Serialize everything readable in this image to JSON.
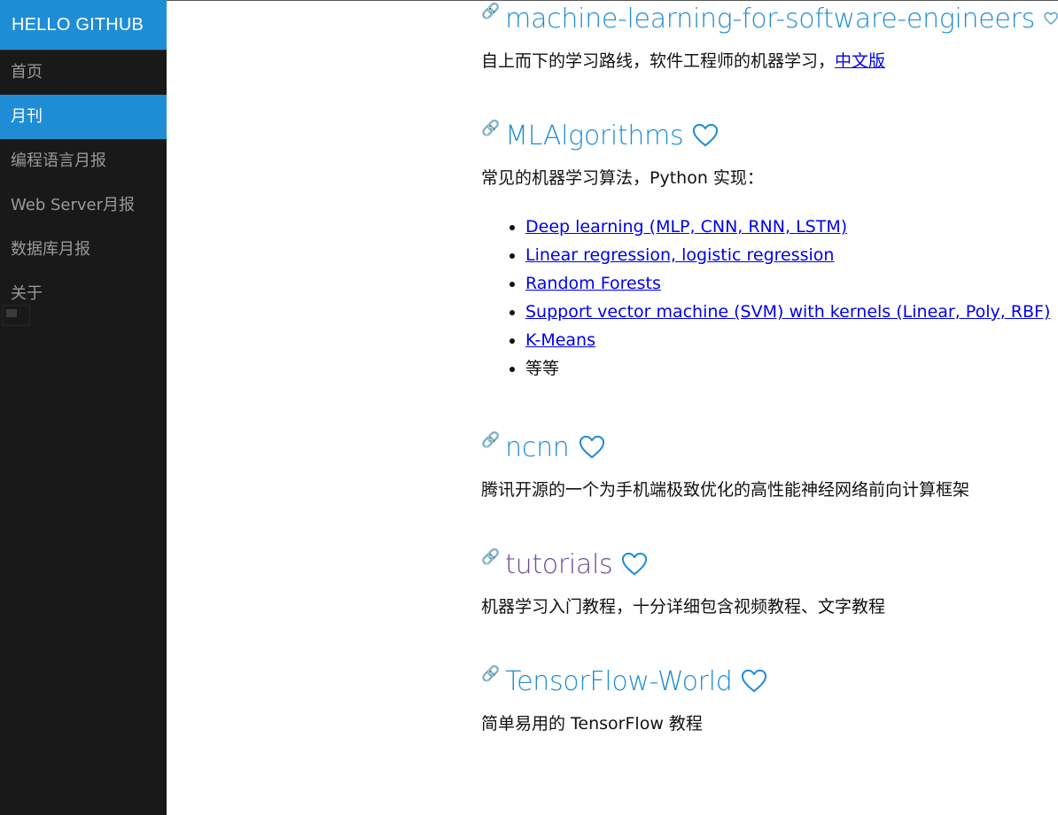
{
  "sidebar": {
    "brand": "HELLO GITHUB",
    "items": [
      {
        "label": "首页",
        "active": false
      },
      {
        "label": "月刊",
        "active": true
      },
      {
        "label": "编程语言月报",
        "active": false
      },
      {
        "label": "Web Server月报",
        "active": false
      },
      {
        "label": "数据库月报",
        "active": false
      },
      {
        "label": "关于",
        "active": false
      }
    ]
  },
  "repos": [
    {
      "title": "machine-learning-for-software-engineers",
      "desc": "自上而下的学习路线，软件工程师的机器学习，",
      "desc_link": "中文版"
    },
    {
      "title": "MLAlgorithms",
      "desc": "常见的机器学习算法，Python 实现：",
      "list": [
        {
          "text": "Deep learning (MLP, CNN, RNN, LSTM)",
          "link": true
        },
        {
          "text": "Linear regression, logistic regression",
          "link": true
        },
        {
          "text": "Random Forests",
          "link": true
        },
        {
          "text": "Support vector machine (SVM) with kernels (Linear, Poly, RBF)",
          "link": true
        },
        {
          "text": "K-Means",
          "link": true
        },
        {
          "text": "等等",
          "link": false
        }
      ]
    },
    {
      "title": "ncnn",
      "desc": "腾讯开源的一个为手机端极致优化的高性能神经网络前向计算框架"
    },
    {
      "title": "tutorials",
      "visited": true,
      "desc": "机器学习入门教程，十分详细包含视频教程、文字教程"
    },
    {
      "title": "TensorFlow-World",
      "desc": "简单易用的 TensorFlow 教程"
    }
  ],
  "icons": {
    "anchor": "link-chain-icon",
    "favorite": "heart-outline-icon"
  },
  "colors": {
    "accent": "#1f8dd6",
    "sidebar_bg": "#191919",
    "link": "#0000ee",
    "visited": "#6b4a9a"
  }
}
